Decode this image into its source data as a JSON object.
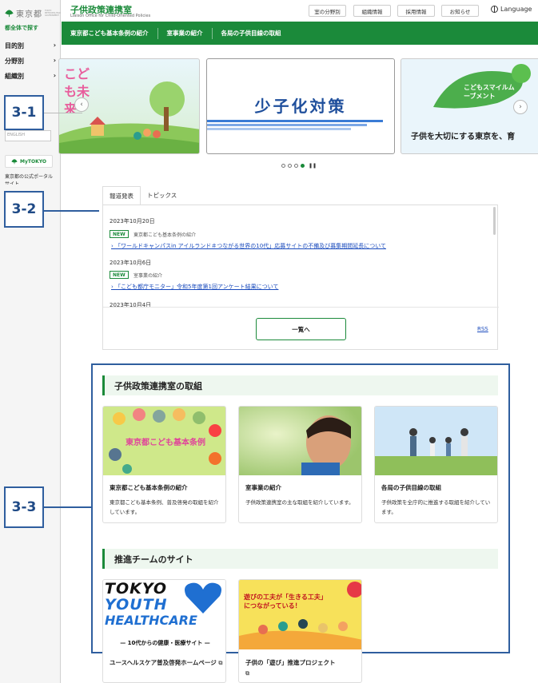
{
  "sidebar": {
    "logo_text": "東京都",
    "logo_sub": "TOKYO METROPOLITAN GOVERNMENT",
    "search_all": "都全体で探す",
    "items": [
      {
        "label": "目的別"
      },
      {
        "label": "分野別"
      },
      {
        "label": "組織別"
      }
    ],
    "small_box_text": "ENGLISH",
    "mytokyo_label": "MyTOKYO",
    "mytokyo_text": "東京都の公式ポータルサイト"
  },
  "header": {
    "title": "子供政策連携室",
    "subtitle": "Liaison Office for Child-Oriented Policies",
    "buttons": [
      "室の分野別",
      "組織情報",
      "採用情報",
      "お知らせ"
    ],
    "language": "Language"
  },
  "gnav": [
    "東京都こども基本条例の紹介",
    "室事業の紹介",
    "各局の子供目線の取組"
  ],
  "carousel": {
    "slide2_text": "少子化対策",
    "slide3_caption": "子供を大切にする東京を、育",
    "slide3_badge": "こどもスマイルムーブメント",
    "slide1_text": "こども未来",
    "dot_count": 4,
    "active_dot": 3,
    "prev_icon": "‹",
    "next_icon": "›",
    "pause_icon": "❚❚"
  },
  "callouts": [
    "3-1",
    "3-2",
    "3-3"
  ],
  "news": {
    "tabs": [
      "報道発表",
      "トピックス"
    ],
    "items": [
      {
        "date": "2023年10月20日",
        "badge": "NEW",
        "category": "東京都こども基本条例の紹介",
        "link": "「ワールドキャンパスin アイルランド＃つながる世界の10代」応募サイトの不備及び募集期間延長について"
      },
      {
        "date": "2023年10月6日",
        "badge": "NEW",
        "category": "室事業の紹介",
        "link": "「こども都庁モニター」令和5年度第1回アンケート結果について"
      },
      {
        "date": "2023年10月4日"
      }
    ],
    "more_label": "一覧へ",
    "rss_label": "RSS"
  },
  "section1": {
    "heading": "子供政策連携室の取組",
    "cards": [
      {
        "title": "東京都こども基本条例の紹介",
        "desc": "東京都こども基本条例、普及啓発の取組を紹介しています。",
        "img_text": "東京都こども基本条例"
      },
      {
        "title": "室事業の紹介",
        "desc": "子供政策連携室の主な取組を紹介しています。"
      },
      {
        "title": "各局の子供目線の取組",
        "desc": "子供政策を全庁的に推進する取組を紹介しています。"
      }
    ]
  },
  "section2": {
    "heading": "推進チームのサイト",
    "cards": [
      {
        "title": "ユースヘルスケア普及啓発ホームページ",
        "img_line1": "TOKYO",
        "img_line2": "YOUTH",
        "img_line3": "HEALTHCARE",
        "img_sub": "— 10代からの健康・医療サイト —"
      },
      {
        "title": "子供の「遊び」推進プロジェクト",
        "img_text": "遊びの工夫が「生きる工夫」につながっている！"
      }
    ]
  },
  "colors": {
    "brand": "#1b8a3a",
    "callout": "#2f5e9e",
    "link": "#1a4bbd"
  }
}
